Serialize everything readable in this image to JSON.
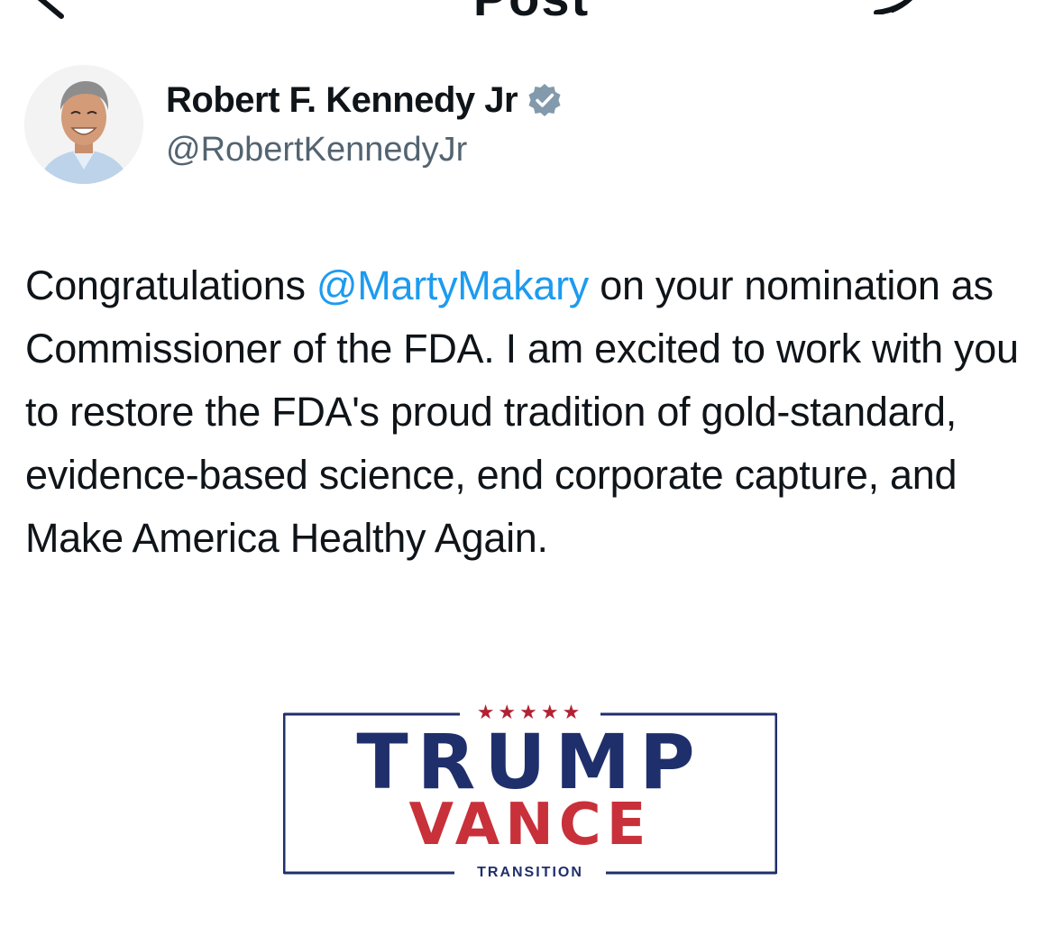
{
  "header": {
    "back_icon": "arrow-left-icon",
    "title": "Post",
    "right_icon": "grok-icon"
  },
  "author": {
    "name": "Robert F. Kennedy Jr",
    "handle": "@RobertKennedyJr",
    "verified": true,
    "verified_icon": "verified-badge-icon",
    "verified_color": "#829aab"
  },
  "tweet": {
    "text_before_mention": "Congratulations ",
    "mention": "@MartyMakary",
    "text_after_mention": " on your nomination as Commissioner of the FDA. I am excited to work with you to restore the FDA's proud tradition of gold-standard, evidence-based science, end corporate capture, and Make America Healthy Again.",
    "mention_color": "#1d9bf0"
  },
  "media": {
    "stars": "★★★★★",
    "line1": "TRUMP",
    "line2": "VANCE",
    "line3": "TRANSITION",
    "navy": "#1f2f6b",
    "red": "#c8313a"
  }
}
